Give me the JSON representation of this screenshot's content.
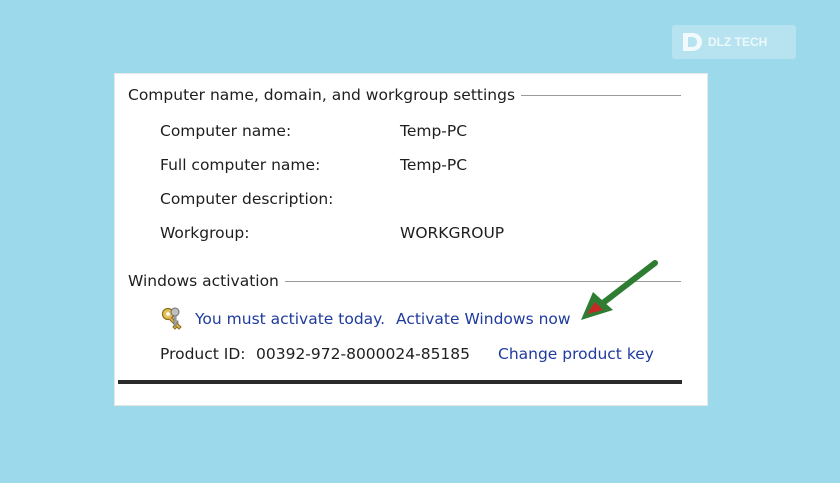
{
  "watermark": {
    "text": "DLZ TECH",
    "icon": "dlz-logo-icon"
  },
  "computer_settings": {
    "header": "Computer name, domain, and workgroup settings",
    "rows": [
      {
        "label": "Computer name:",
        "value": "Temp-PC"
      },
      {
        "label": "Full computer name:",
        "value": "Temp-PC"
      },
      {
        "label": "Computer description:",
        "value": ""
      },
      {
        "label": "Workgroup:",
        "value": "WORKGROUP"
      }
    ]
  },
  "activation": {
    "header": "Windows activation",
    "icon": "keys-icon",
    "message": "You must activate today.",
    "activate_link": "Activate Windows now",
    "product_id_label": "Product ID:",
    "product_id_value": "00392-972-8000024-85185",
    "change_key_link": "Change product key"
  },
  "colors": {
    "background": "#9cd9ea",
    "link": "#1f3b9e",
    "arrow": "#2e7d32",
    "arrow_head": "#c62828"
  }
}
